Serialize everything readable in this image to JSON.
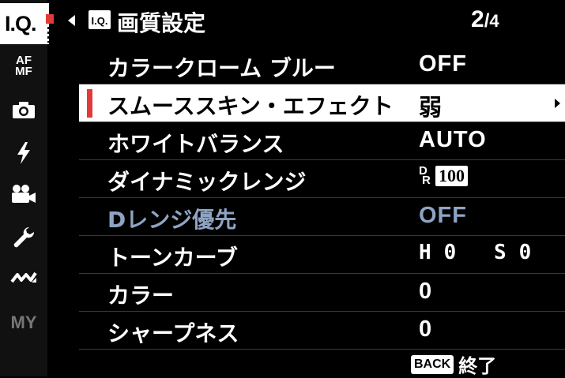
{
  "sidebar": {
    "tabs": [
      {
        "id": "iq",
        "label": "I.Q.",
        "icon": "image-quality-icon",
        "active": true
      },
      {
        "id": "af",
        "label_top": "AF",
        "label_bottom": "MF",
        "icon": "af-mf-icon"
      },
      {
        "id": "shooting",
        "icon": "camera-icon"
      },
      {
        "id": "flash",
        "icon": "flash-icon"
      },
      {
        "id": "movie",
        "icon": "movie-camera-icon"
      },
      {
        "id": "setup",
        "icon": "wrench-icon"
      },
      {
        "id": "connection",
        "icon": "wireless-icon"
      },
      {
        "id": "my",
        "label": "MY",
        "icon": "my-menu-icon"
      }
    ],
    "accent_color": "#e03a3a"
  },
  "header": {
    "badge": "I.Q.",
    "title": "画質設定",
    "page_current": "2",
    "page_separator": "/",
    "page_total": "4"
  },
  "menu": {
    "items": [
      {
        "label": "カラークローム ブルー",
        "value": "OFF"
      },
      {
        "label": "スムーススキン・エフェクト",
        "value": "弱",
        "selected": true
      },
      {
        "label": "ホワイトバランス",
        "value": "AUTO"
      },
      {
        "label": "ダイナミックレンジ",
        "value_icon_letters": "DR",
        "value": "100"
      },
      {
        "label": "Dレンジ優先",
        "value": "OFF",
        "disabled": true
      },
      {
        "label": "トーンカーブ",
        "value": "H0 S0"
      },
      {
        "label": "カラー",
        "value": "0"
      },
      {
        "label": "シャープネス",
        "value": "0"
      }
    ]
  },
  "footer": {
    "back_badge": "BACK",
    "exit_label": "終了"
  }
}
